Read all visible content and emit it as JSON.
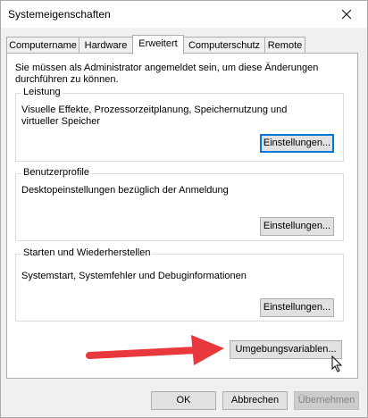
{
  "window": {
    "title": "Systemeigenschaften",
    "close_icon": "close-icon"
  },
  "tabs": [
    {
      "label": "Computername",
      "active": false
    },
    {
      "label": "Hardware",
      "active": false
    },
    {
      "label": "Erweitert",
      "active": true
    },
    {
      "label": "Computerschutz",
      "active": false
    },
    {
      "label": "Remote",
      "active": false
    }
  ],
  "panel": {
    "note": "Sie müssen als Administrator angemeldet sein, um diese Änderungen durchführen zu können.",
    "performance": {
      "legend": "Leistung",
      "text": "Visuelle Effekte, Prozessorzeitplanung, Speichernutzung und virtueller Speicher",
      "button": "Einstellungen..."
    },
    "profiles": {
      "legend": "Benutzerprofile",
      "text": "Desktopeinstellungen bezüglich der Anmeldung",
      "button": "Einstellungen..."
    },
    "startup": {
      "legend": "Starten und Wiederherstellen",
      "text": "Systemstart, Systemfehler und Debuginformationen",
      "button": "Einstellungen..."
    },
    "env_button": "Umgebungsvariablen..."
  },
  "footer": {
    "ok": "OK",
    "cancel": "Abbrechen",
    "apply": "Übernehmen"
  },
  "colors": {
    "accent": "#0078d7",
    "arrow": "#e8383d"
  }
}
